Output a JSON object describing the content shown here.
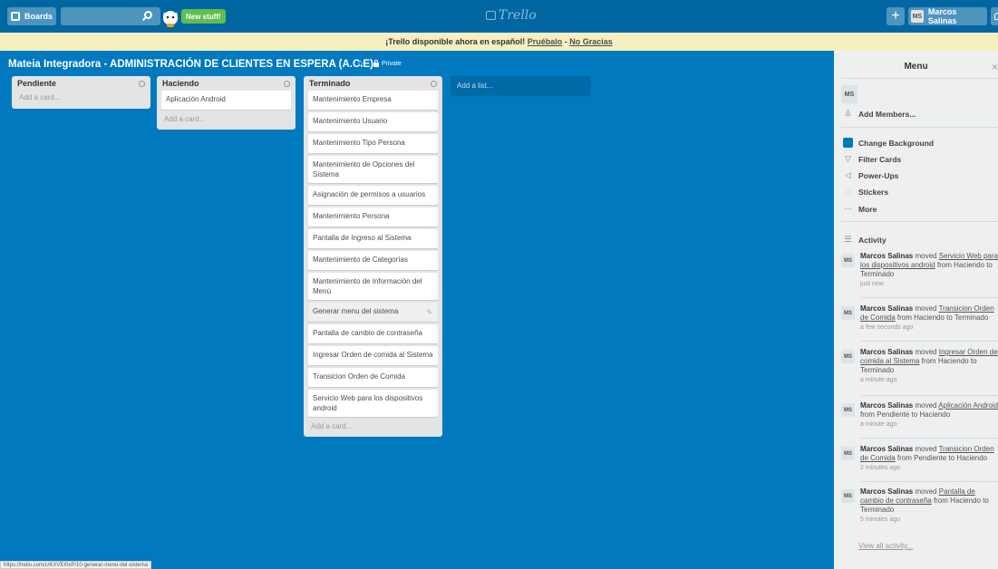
{
  "header": {
    "boards_label": "Boards",
    "new_stuff_label": "New stuff!",
    "logo_text": "Trello",
    "plus_label": "+",
    "user_initials": "MS",
    "user_name": "Marcos Salinas"
  },
  "banner": {
    "text": "¡Trello disponible ahora en español!",
    "try_link": "Pruébalo",
    "separator": " - ",
    "dismiss_link": "No Gracias"
  },
  "board": {
    "title": "Mateia Integradora - ADMINISTRACIÓN DE CLIENTES EN ESPERA (A.C.E)",
    "star": "☆",
    "visibility": "Private",
    "add_list": "Add a list..."
  },
  "lists": [
    {
      "title": "Pendiente",
      "cards": [],
      "add_card": "Add a card..."
    },
    {
      "title": "Haciendo",
      "cards": [
        "Aplicación Android"
      ],
      "add_card": "Add a card..."
    },
    {
      "title": "Terminado",
      "cards": [
        "Mantenimiento Empresa",
        "Mantenimiento Usuario",
        "Mantenimiento Tipo Persona",
        "Mantenimiento de Opciones del Sistema",
        "Asignación de permisos a usuarios",
        "Mantenimiento Persona",
        "Pantalla de Ingreso al Sistema",
        "Mantenimiento de Categorías",
        "Mantenimiento de Información del Menú",
        "Generar menu del sistema",
        "Pantalla de cambio de contraseña",
        "Ingresar Orden de comida al Sistema",
        "Transicion Orden de Comida",
        "Servicio Web para los dispositivos android"
      ],
      "add_card": "Add a card..."
    }
  ],
  "sidebar": {
    "title": "Menu",
    "close": "×",
    "member_initials": "MS",
    "add_members": "Add Members...",
    "items": [
      "Change Background",
      "Filter Cards",
      "Power-Ups",
      "Stickers",
      "More"
    ],
    "activity_title": "Activity",
    "activities": [
      {
        "user": "Marcos Salinas",
        "verb": "moved",
        "card": "Servicio Web para los dispositivos android",
        "rest": "from Haciendo to Terminado",
        "time": "just now"
      },
      {
        "user": "Marcos Salinas",
        "verb": "moved",
        "card": "Transicion Orden de Comida",
        "rest": "from Haciendo to Terminado",
        "time": "a few seconds ago"
      },
      {
        "user": "Marcos Salinas",
        "verb": "moved",
        "card": "Ingresar Orden de comida al Sistema",
        "rest": "from Haciendo to Terminado",
        "time": "a minute ago"
      },
      {
        "user": "Marcos Salinas",
        "verb": "moved",
        "card": "Aplicación Android",
        "rest": "from Pendiente to Haciendo",
        "time": "a minute ago"
      },
      {
        "user": "Marcos Salinas",
        "verb": "moved",
        "card": "Transicion Orden de Comida",
        "rest": "from Pendiente to Haciendo",
        "time": "2 minutes ago"
      },
      {
        "user": "Marcos Salinas",
        "verb": "moved",
        "card": "Pantalla de cambio de contraseña",
        "rest": "from Haciendo to Terminado",
        "time": "5 minutes ago"
      }
    ],
    "view_all": "View all activity..."
  },
  "status_url": "https://trello.com/c/KXVEI0xP/10-generar-menu-del-sistema",
  "colors": {
    "board_bg": "#0079bf",
    "header_bg": "#0067a3",
    "accent_green": "#61bd4f",
    "banner_bg": "#f6f0c1"
  }
}
